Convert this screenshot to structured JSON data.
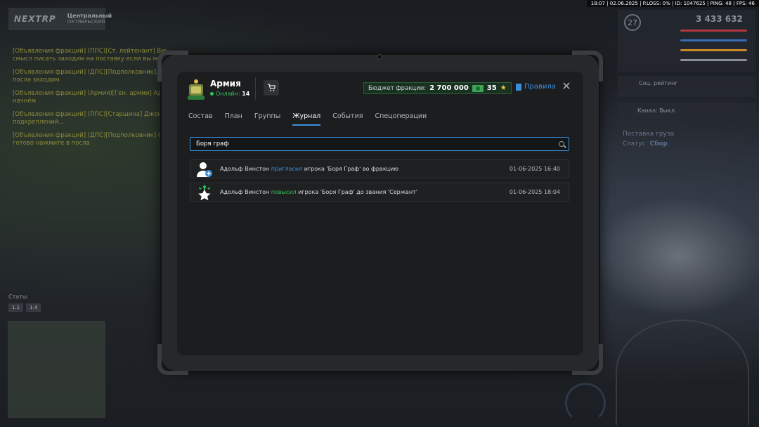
{
  "topbar": {
    "text": "18:07 | 02.06.2025 | P.LOSS: 0% | ID: 1047625 | PING: 48 | FPS: 46"
  },
  "hud_left": {
    "logo": "NEXTRP",
    "district_title": "Центральный",
    "district_sub": "ОКТЯБРЬСКИЙ",
    "chat": [
      "[Объявления фракций] (ППС)[Ст. лейтенант] Винстон...",
      "смысл писать заходим на поставку если вы не",
      "[Объявления фракций] (ДПС)[Подполковник]...",
      "посла заходим",
      "[Объявления фракций] (Армия)[Ген. армии] Ад...",
      "начнём",
      "[Объявления фракций] (ППС)[Старшина] Джон...",
      "подкреплений...",
      "[Объявления фракций] (ДПС)[Подполковник] О...",
      "готово нажмите в посла"
    ],
    "stats_label": "Статы:",
    "stat_buttons": [
      "1.1",
      "1.4"
    ]
  },
  "hud_right": {
    "level": "27",
    "money": "3 433 632",
    "social_rating": "Соц. рейтинг",
    "radio": "Канал: Выкл.",
    "cargo_title": "Поставка груза",
    "cargo_status_label": "Статус:",
    "cargo_status": "Сбор",
    "bar_colors": [
      "#b3373d",
      "#3a6bb5",
      "#c98a2a",
      "#8b9097"
    ]
  },
  "tablet": {
    "faction_name": "Армия",
    "online_label": "Онлайн:",
    "online_count": "14",
    "budget_label": "Бюджет фракции:",
    "budget_value": "2 700 000",
    "budget_secondary": "35",
    "rules_label": "Правила",
    "close_icon": "close-icon",
    "tabs": [
      "Состав",
      "План",
      "Группы",
      "Журнал",
      "События",
      "Спецоперации"
    ],
    "active_tab": "Журнал",
    "search_value": "Боря граф",
    "log": [
      {
        "actor": "Адольф Винстон",
        "action": "пригласил",
        "rest": " игрока 'Боря Граф' во фракцию",
        "time": "01-06-2025 16:40",
        "icon": "user-plus-icon"
      },
      {
        "actor": "Адольф Винстон",
        "action": "повысил",
        "rest": " игрока 'Боря Граф' до звания 'Сержант'",
        "time": "01-06-2025 18:04",
        "icon": "promote-star-icon"
      }
    ],
    "colors": {
      "accent": "#3a8fd9",
      "online": "#32c65a",
      "budget_bg": "#183121"
    }
  }
}
